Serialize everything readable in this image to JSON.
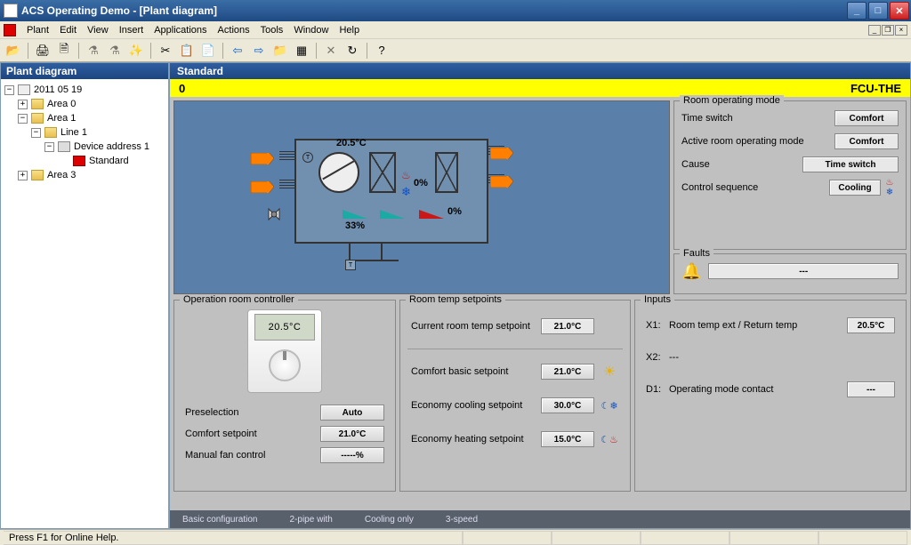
{
  "window": {
    "title": "ACS Operating Demo - [Plant diagram]"
  },
  "menu": {
    "plant": "Plant",
    "edit": "Edit",
    "view": "View",
    "insert": "Insert",
    "applications": "Applications",
    "actions": "Actions",
    "tools": "Tools",
    "window": "Window",
    "help": "Help"
  },
  "tree": {
    "header": "Plant diagram",
    "root": "2011 05 19",
    "area0": "Area 0",
    "area1": "Area 1",
    "line1": "Line 1",
    "dev1": "Device address 1",
    "std": "Standard",
    "area3": "Area 3"
  },
  "content": {
    "header": "Standard"
  },
  "status_yellow": {
    "left": "0",
    "right": "FCU-THE"
  },
  "diagram": {
    "supply_temp": "20.5°C",
    "fan_pct": "33%",
    "cool_pct": "0%",
    "heat_pct": "0%"
  },
  "room_mode": {
    "title": "Room operating mode",
    "time_switch_lbl": "Time switch",
    "time_switch_val": "Comfort",
    "active_lbl": "Active room operating mode",
    "active_val": "Comfort",
    "cause_lbl": "Cause",
    "cause_val": "Time switch",
    "ctrl_lbl": "Control sequence",
    "ctrl_val": "Cooling"
  },
  "faults": {
    "title": "Faults",
    "val": "---"
  },
  "op_room": {
    "title": "Operation room controller",
    "display": "20.5°C",
    "presel_lbl": "Preselection",
    "presel_val": "Auto",
    "comfort_lbl": "Comfort setpoint",
    "comfort_val": "21.0°C",
    "fan_lbl": "Manual fan control",
    "fan_val": "-----%"
  },
  "setpoints": {
    "title": "Room temp setpoints",
    "current_lbl": "Current room temp setpoint",
    "current_val": "21.0°C",
    "comfort_lbl": "Comfort basic setpoint",
    "comfort_val": "21.0°C",
    "eco_cool_lbl": "Economy cooling setpoint",
    "eco_cool_val": "30.0°C",
    "eco_heat_lbl": "Economy heating setpoint",
    "eco_heat_val": "15.0°C"
  },
  "inputs": {
    "title": "Inputs",
    "x1_lbl": "X1:",
    "x1_desc": "Room temp ext / Return temp",
    "x1_val": "20.5°C",
    "x2_lbl": "X2:",
    "x2_desc": "---",
    "d1_lbl": "D1:",
    "d1_desc": "Operating mode contact",
    "d1_val": "---"
  },
  "footer": {
    "a": "Basic configuration",
    "b": "2-pipe with",
    "c": "Cooling only",
    "d": "3-speed"
  },
  "statusbar": {
    "hint": "Press F1 for Online Help."
  }
}
